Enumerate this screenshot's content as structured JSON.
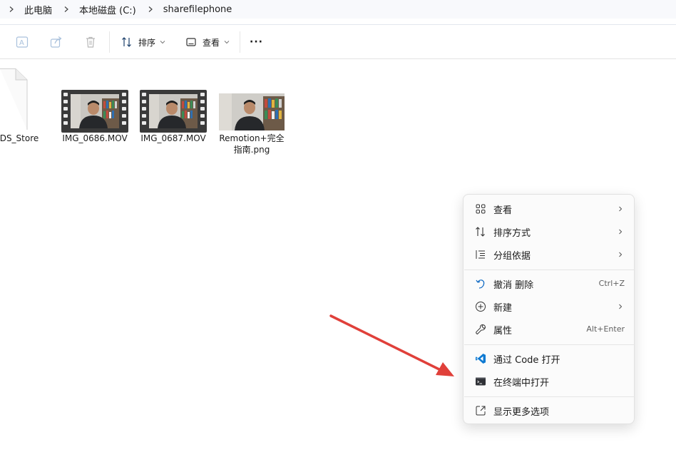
{
  "breadcrumb": {
    "items": [
      "此电脑",
      "本地磁盘 (C:)",
      "sharefilephone"
    ]
  },
  "toolbar": {
    "sort_label": "排序",
    "view_label": "查看",
    "more_label": "···"
  },
  "files": [
    {
      "name": "DS_Store"
    },
    {
      "name": "IMG_0686.MOV"
    },
    {
      "name": "IMG_0687.MOV"
    },
    {
      "name": "Remotion+完全指南.png"
    }
  ],
  "context_menu": {
    "view": {
      "label": "查看"
    },
    "sort": {
      "label": "排序方式"
    },
    "group": {
      "label": "分组依据"
    },
    "undo": {
      "label": "撤消 删除",
      "shortcut": "Ctrl+Z"
    },
    "new": {
      "label": "新建"
    },
    "properties": {
      "label": "属性",
      "shortcut": "Alt+Enter"
    },
    "vscode": {
      "label": "通过 Code 打开"
    },
    "terminal": {
      "label": "在终端中打开"
    },
    "more": {
      "label": "显示更多选项"
    }
  },
  "colors": {
    "accent": "#0a66c2",
    "annotation_arrow": "#e0403a",
    "vscode": "#0f7ad2"
  },
  "icons": {
    "toolbar": [
      "rename-icon",
      "share-icon",
      "delete-icon",
      "sort-icon",
      "view-icon",
      "more-icon"
    ],
    "menu": [
      "grid-icon",
      "sort-icon",
      "group-list-icon",
      "undo-icon",
      "plus-circle-icon",
      "wrench-icon",
      "vscode-icon",
      "terminal-icon",
      "open-external-icon"
    ]
  }
}
